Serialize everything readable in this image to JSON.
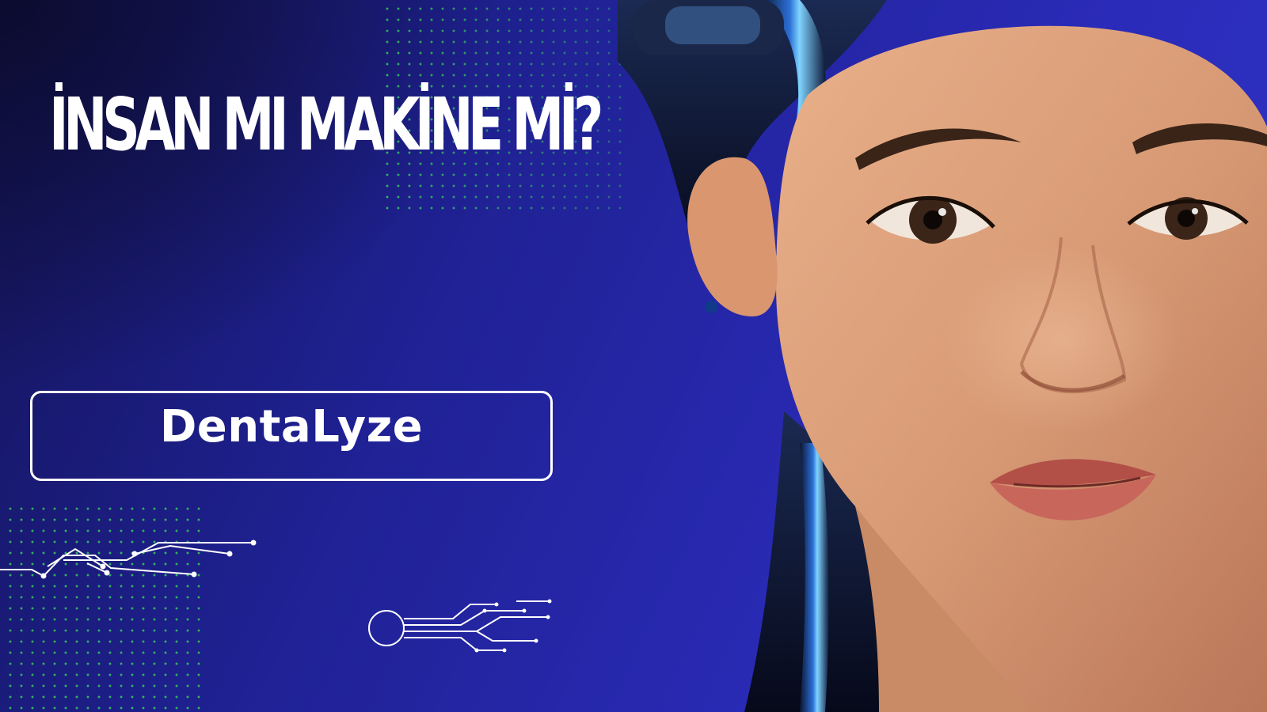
{
  "headline": "İNSAN MI MAKİNE Mİ?",
  "brand": {
    "name": "DentaLyze"
  },
  "colors": {
    "background": "#1f2193",
    "dots": "#39e05a",
    "text": "#ffffff"
  },
  "decor": {
    "portrait": "cyborg-woman-portrait",
    "circuits": [
      "circuit-lines-icon",
      "circuit-node-icon"
    ]
  }
}
